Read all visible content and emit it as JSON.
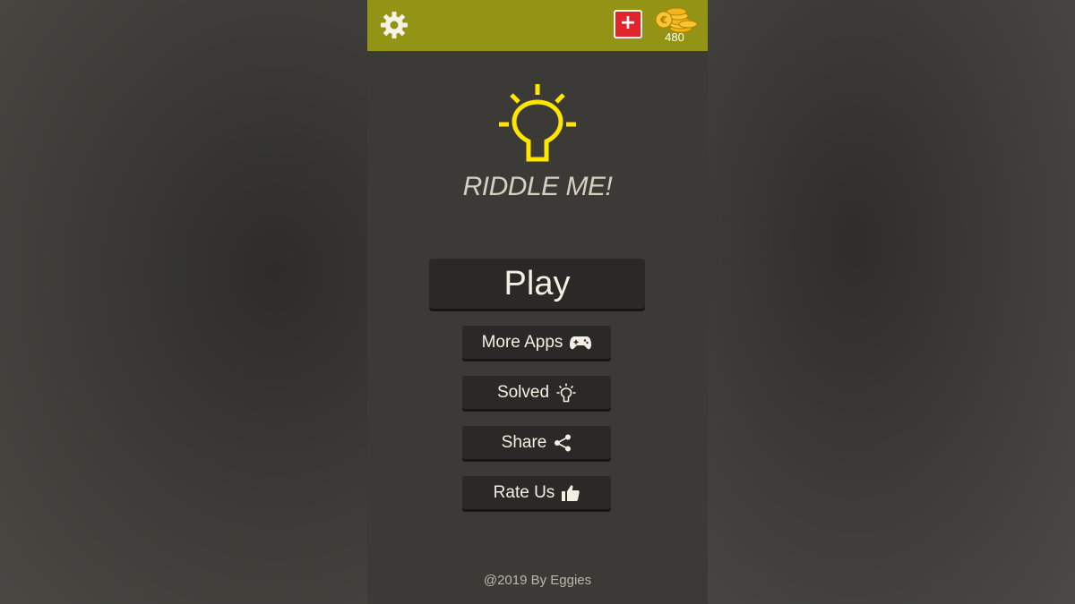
{
  "app": {
    "title": "RIDDLE ME!",
    "coins": "480",
    "plus_label": "+"
  },
  "menu": {
    "play": "Play",
    "more_apps": "More Apps",
    "solved": "Solved",
    "share": "Share",
    "rate_us": "Rate Us"
  },
  "footer": {
    "credit": "@2019 By Eggies"
  },
  "icons": {
    "settings": "gear-icon",
    "add_coins": "plus-icon",
    "coins": "coins-icon",
    "logo": "lightbulb-icon",
    "more_apps": "gamepad-icon",
    "solved": "lightbulb-icon",
    "share": "share-icon",
    "rate_us": "thumbs-up-icon"
  },
  "colors": {
    "topbar": "#939316",
    "background": "#3b3a36",
    "button": "#2a2927",
    "accent": "#ffe600",
    "plus_button": "#e0252b"
  }
}
